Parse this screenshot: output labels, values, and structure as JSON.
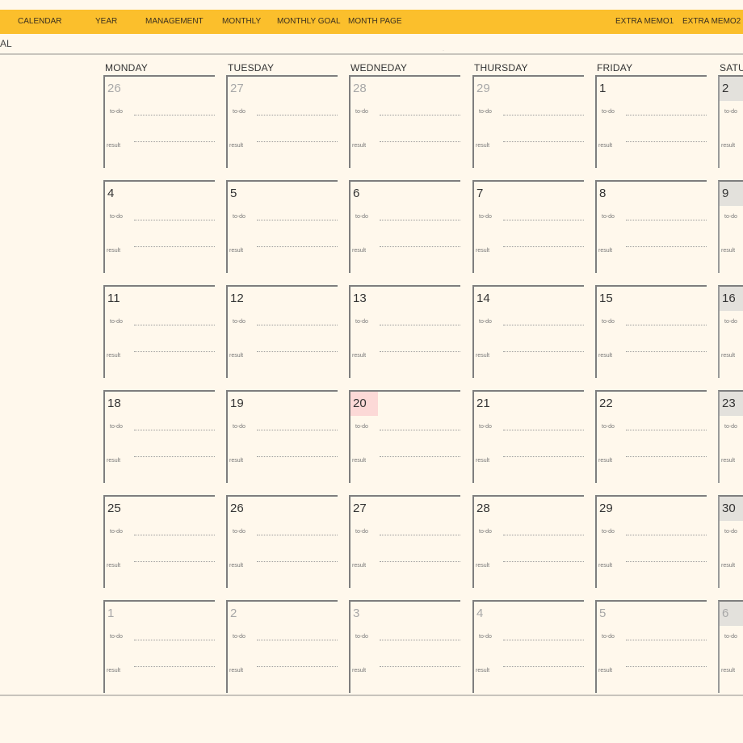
{
  "nav": {
    "tabs": [
      "CALENDAR",
      "YEAR",
      "MANAGEMENT",
      "MONTHLY",
      "MONTHLY GOAL",
      "MONTH PAGE",
      "EXTRA MEMO1",
      "EXTRA MEMO2"
    ]
  },
  "goal": {
    "label": "AL"
  },
  "weekdays": [
    "MONDAY",
    "TUESDAY",
    "WEDNEDAY",
    "THURSDAY",
    "FRIDAY",
    "SATUR"
  ],
  "cell_labels": {
    "todo": "to-do",
    "result": "result"
  },
  "weeks": [
    [
      {
        "d": "26",
        "dim": true
      },
      {
        "d": "27",
        "dim": true
      },
      {
        "d": "28",
        "dim": true
      },
      {
        "d": "29",
        "dim": true
      },
      {
        "d": "1"
      },
      {
        "d": "2",
        "sat": true
      }
    ],
    [
      {
        "d": "4"
      },
      {
        "d": "5"
      },
      {
        "d": "6"
      },
      {
        "d": "7"
      },
      {
        "d": "8"
      },
      {
        "d": "9",
        "sat": true
      }
    ],
    [
      {
        "d": "11"
      },
      {
        "d": "12"
      },
      {
        "d": "13"
      },
      {
        "d": "14"
      },
      {
        "d": "15"
      },
      {
        "d": "16",
        "sat": true
      }
    ],
    [
      {
        "d": "18"
      },
      {
        "d": "19"
      },
      {
        "d": "20",
        "today": true
      },
      {
        "d": "21"
      },
      {
        "d": "22"
      },
      {
        "d": "23",
        "sat": true
      }
    ],
    [
      {
        "d": "25"
      },
      {
        "d": "26"
      },
      {
        "d": "27"
      },
      {
        "d": "28"
      },
      {
        "d": "29"
      },
      {
        "d": "30",
        "sat": true
      }
    ],
    [
      {
        "d": "1",
        "dim": true
      },
      {
        "d": "2",
        "dim": true
      },
      {
        "d": "3",
        "dim": true
      },
      {
        "d": "4",
        "dim": true
      },
      {
        "d": "5",
        "dim": true
      },
      {
        "d": "6",
        "dim": true,
        "sat": true
      }
    ]
  ],
  "colors": {
    "background": "#fff8ec",
    "topbar": "#fbbf2c",
    "today_highlight": "#fcd9d7",
    "saturday_highlight": "#e3e1dc",
    "grid_line": "#7e7e7e"
  }
}
